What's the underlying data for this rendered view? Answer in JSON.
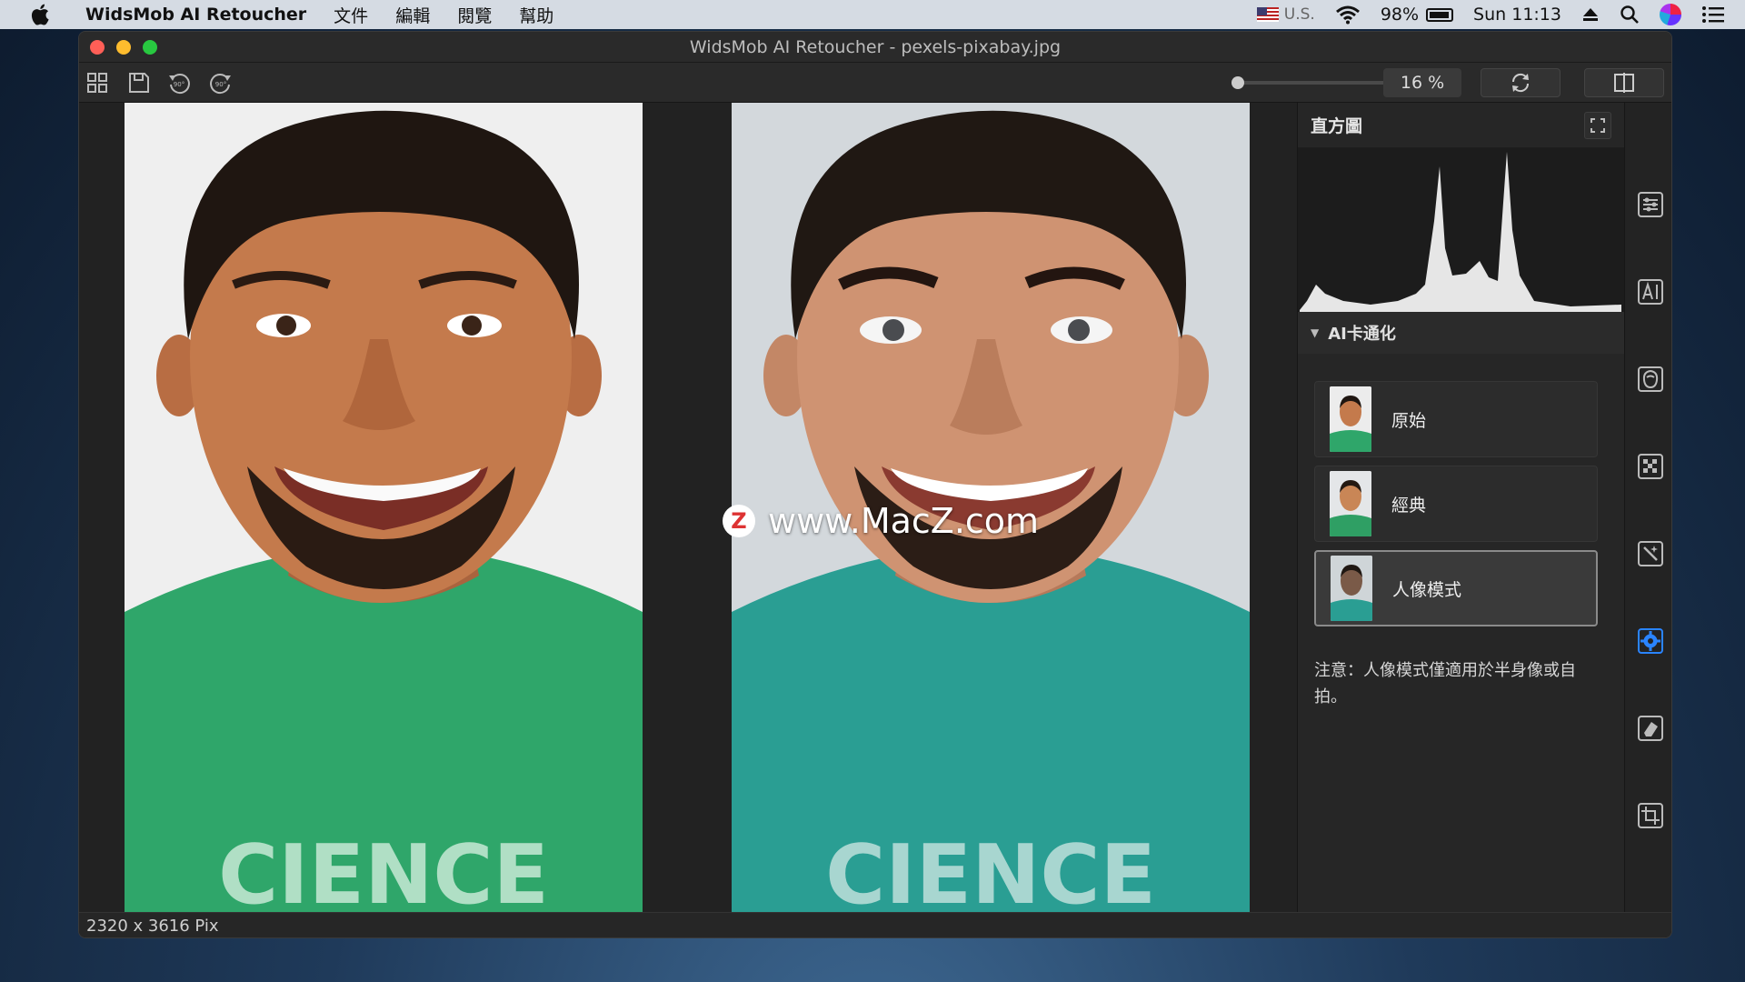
{
  "menubar": {
    "app_name": "WidsMob AI Retoucher",
    "menus": [
      "文件",
      "編輯",
      "閱覽",
      "幫助"
    ],
    "keyboard": "U.S.",
    "battery": "98%",
    "clock": "Sun 11:13"
  },
  "window": {
    "title": "WidsMob AI Retoucher - pexels-pixabay.jpg"
  },
  "toolbar": {
    "zoom_value": "16 %",
    "rotate_left_label": "90°",
    "rotate_right_label": "90°",
    "zoom_slider_level": 0.0
  },
  "watermark": {
    "logo_letter": "Z",
    "text": "www.MacZ.com"
  },
  "status": {
    "dimensions": "2320 x 3616 Pix"
  },
  "panel": {
    "histogram_title": "直方圖",
    "section_title": "AI卡通化",
    "styles": [
      {
        "label": "原始",
        "selected": false
      },
      {
        "label": "經典",
        "selected": false
      },
      {
        "label": "人像模式",
        "selected": true
      }
    ],
    "note": "注意：人像模式僅適用於半身像或自拍。"
  },
  "side_tools": [
    "adjust-sliders-icon",
    "ai-icon",
    "face-icon",
    "mosaic-icon",
    "magic-wand-icon",
    "cartoon-gear-icon",
    "eraser-icon",
    "crop-icon"
  ],
  "colors": {
    "accent": "#2a84ff",
    "tshirt_before": "#2fa66a",
    "tshirt_after": "#2a9e93"
  }
}
